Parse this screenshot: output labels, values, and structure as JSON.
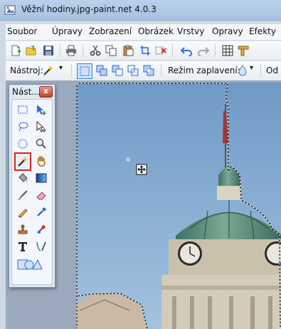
{
  "window": {
    "title": "Věžní hodiny.jpg-paint.net 4.0.3"
  },
  "menu": [
    "Soubor",
    "Úpravy",
    "Zobrazení",
    "Obrázek",
    "Vrstvy",
    "Opravy",
    "Efekty"
  ],
  "toolbar": {
    "tool_label": "Nástroj:",
    "fill_mode_label": "Režim zaplavení:",
    "trailing_label": "Od"
  },
  "tools_window": {
    "title": "Nást...",
    "close_glyph": "x",
    "active_tool": "magic-wand",
    "tools": [
      "rectangle-select",
      "move-selected-pixels",
      "lasso-select",
      "move-selection",
      "ellipse-select",
      "zoom",
      "magic-wand",
      "pan",
      "paint-bucket",
      "gradient",
      "paintbrush",
      "eraser",
      "pencil",
      "color-picker",
      "clone-stamp",
      "recolor",
      "text",
      "line-curve",
      "shapes"
    ]
  },
  "colors": {
    "sky": "#7ea6cc",
    "dome": "#5e8f79",
    "accent_red": "#d8261f"
  }
}
